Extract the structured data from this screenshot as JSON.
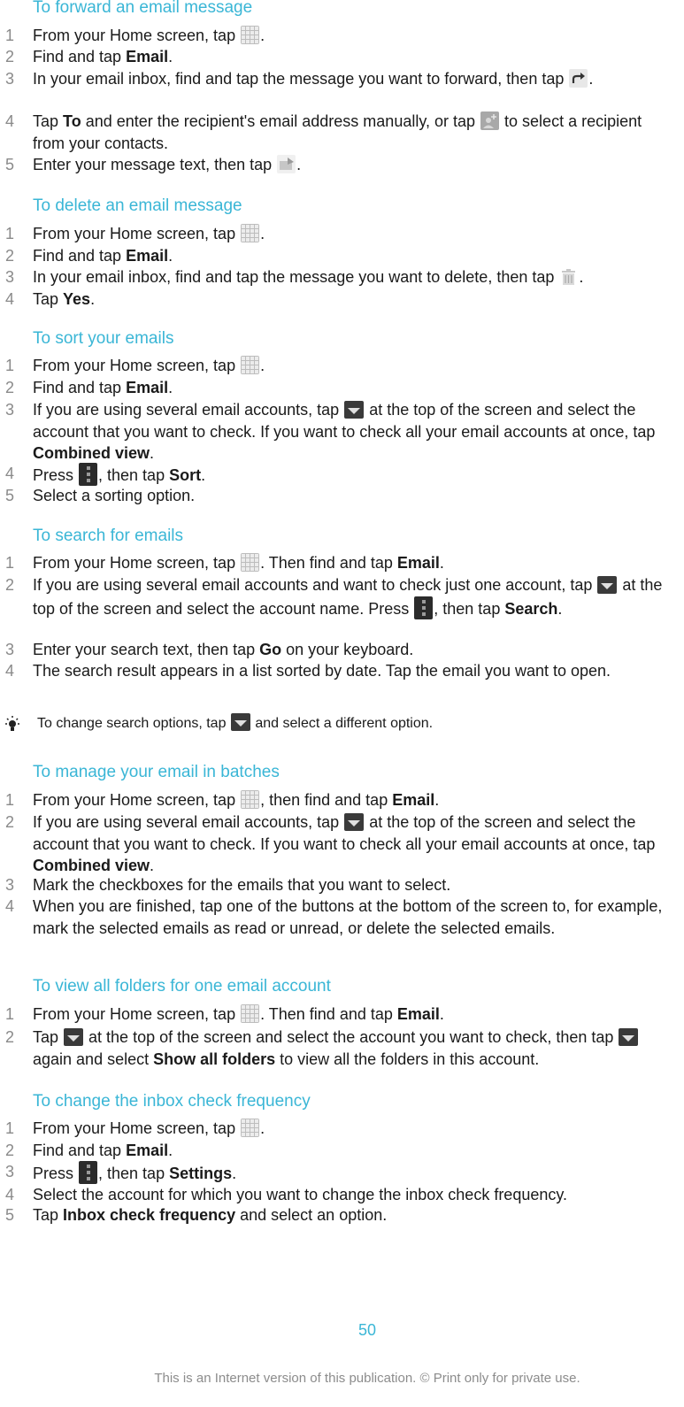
{
  "sections": [
    {
      "heading": "To forward an email message",
      "steps": [
        {
          "num": "1",
          "parts": [
            {
              "t": "From your Home screen, tap "
            },
            {
              "icon": "apps-grid-icon"
            },
            {
              "t": "."
            }
          ]
        },
        {
          "num": "2",
          "parts": [
            {
              "t": "Find and tap "
            },
            {
              "b": "Email"
            },
            {
              "t": "."
            }
          ]
        },
        {
          "num": "3",
          "parts": [
            {
              "t": "In your email inbox, find and tap the message you want to forward, then tap "
            },
            {
              "icon": "forward-arrow-icon"
            },
            {
              "t": "."
            }
          ]
        },
        {
          "num": "4",
          "parts": [
            {
              "t": "Tap "
            },
            {
              "b": "To"
            },
            {
              "t": " and enter the recipient's email address manually, or tap "
            },
            {
              "icon": "add-contact-icon"
            },
            {
              "t": " to select a recipient from your contacts."
            }
          ]
        },
        {
          "num": "5",
          "parts": [
            {
              "t": "Enter your message text, then tap "
            },
            {
              "icon": "send-icon"
            },
            {
              "t": "."
            }
          ]
        }
      ]
    },
    {
      "heading": "To delete an email message",
      "steps": [
        {
          "num": "1",
          "parts": [
            {
              "t": "From your Home screen, tap "
            },
            {
              "icon": "apps-grid-icon"
            },
            {
              "t": "."
            }
          ]
        },
        {
          "num": "2",
          "parts": [
            {
              "t": "Find and tap "
            },
            {
              "b": "Email"
            },
            {
              "t": "."
            }
          ]
        },
        {
          "num": "3",
          "parts": [
            {
              "t": "In your email inbox, find and tap the message you want to delete, then tap "
            },
            {
              "icon": "trash-icon"
            },
            {
              "t": "."
            }
          ]
        },
        {
          "num": "4",
          "parts": [
            {
              "t": "Tap "
            },
            {
              "b": "Yes"
            },
            {
              "t": "."
            }
          ]
        }
      ]
    },
    {
      "heading": "To sort your emails",
      "steps": [
        {
          "num": "1",
          "parts": [
            {
              "t": "From your Home screen, tap "
            },
            {
              "icon": "apps-grid-icon"
            },
            {
              "t": "."
            }
          ]
        },
        {
          "num": "2",
          "parts": [
            {
              "t": "Find and tap "
            },
            {
              "b": "Email"
            },
            {
              "t": "."
            }
          ]
        },
        {
          "num": "3",
          "parts": [
            {
              "t": "If you are using several email accounts, tap "
            },
            {
              "icon": "dropdown-icon"
            },
            {
              "t": " at the top of the screen and select the account that you want to check. If you want to check all your email accounts at once, tap "
            },
            {
              "b": "Combined view"
            },
            {
              "t": "."
            }
          ]
        },
        {
          "num": "4",
          "parts": [
            {
              "t": "Press "
            },
            {
              "icon": "menu-key-icon"
            },
            {
              "t": ", then tap "
            },
            {
              "b": "Sort"
            },
            {
              "t": "."
            }
          ]
        },
        {
          "num": "5",
          "parts": [
            {
              "t": "Select a sorting option."
            }
          ]
        }
      ]
    },
    {
      "heading": "To search for emails",
      "steps": [
        {
          "num": "1",
          "parts": [
            {
              "t": "From your Home screen, tap "
            },
            {
              "icon": "apps-grid-icon"
            },
            {
              "t": ". Then find and tap "
            },
            {
              "b": "Email"
            },
            {
              "t": "."
            }
          ]
        },
        {
          "num": "2",
          "parts": [
            {
              "t": "If you are using several email accounts and want to check just one account, tap "
            },
            {
              "icon": "dropdown-icon"
            },
            {
              "t": " at the top of the screen and select the account name. Press "
            },
            {
              "icon": "menu-key-icon"
            },
            {
              "t": ", then tap "
            },
            {
              "b": "Search"
            },
            {
              "t": "."
            }
          ]
        },
        {
          "num": "3",
          "parts": [
            {
              "t": "Enter your search text, then tap "
            },
            {
              "b": "Go"
            },
            {
              "t": " on your keyboard."
            }
          ]
        },
        {
          "num": "4",
          "parts": [
            {
              "t": "The search result appears in a list sorted by date. Tap the email you want to open."
            }
          ]
        }
      ],
      "tip": {
        "parts": [
          {
            "t": "To change search options, tap "
          },
          {
            "icon": "dropdown-icon"
          },
          {
            "t": " and select a different option."
          }
        ]
      }
    },
    {
      "heading": "To manage your email in batches",
      "steps": [
        {
          "num": "1",
          "parts": [
            {
              "t": "From your Home screen, tap "
            },
            {
              "icon": "apps-grid-icon"
            },
            {
              "t": ", then find and tap "
            },
            {
              "b": "Email"
            },
            {
              "t": "."
            }
          ]
        },
        {
          "num": "2",
          "parts": [
            {
              "t": "If you are using several email accounts, tap "
            },
            {
              "icon": "dropdown-icon"
            },
            {
              "t": " at the top of the screen and select the account that you want to check. If you want to check all your email accounts at once, tap "
            },
            {
              "b": "Combined view"
            },
            {
              "t": "."
            }
          ]
        },
        {
          "num": "3",
          "parts": [
            {
              "t": "Mark the checkboxes for the emails that you want to select."
            }
          ]
        },
        {
          "num": "4",
          "parts": [
            {
              "t": "When you are finished, tap one of the buttons at the bottom of the screen to, for example, mark the selected emails as read or unread, or delete the selected emails."
            }
          ]
        }
      ]
    },
    {
      "heading": "To view all folders for one email account",
      "steps": [
        {
          "num": "1",
          "parts": [
            {
              "t": "From your Home screen, tap "
            },
            {
              "icon": "apps-grid-icon"
            },
            {
              "t": ". Then find and tap "
            },
            {
              "b": "Email"
            },
            {
              "t": "."
            }
          ]
        },
        {
          "num": "2",
          "parts": [
            {
              "t": "Tap "
            },
            {
              "icon": "dropdown-icon"
            },
            {
              "t": " at the top of the screen and select the account you want to check, then tap "
            },
            {
              "icon": "dropdown-icon"
            },
            {
              "t": " again and select "
            },
            {
              "b": "Show all folders"
            },
            {
              "t": " to view all the folders in this account."
            }
          ]
        }
      ]
    },
    {
      "heading": "To change the inbox check frequency",
      "steps": [
        {
          "num": "1",
          "parts": [
            {
              "t": "From your Home screen, tap "
            },
            {
              "icon": "apps-grid-icon"
            },
            {
              "t": "."
            }
          ]
        },
        {
          "num": "2",
          "parts": [
            {
              "t": "Find and tap "
            },
            {
              "b": "Email"
            },
            {
              "t": "."
            }
          ]
        },
        {
          "num": "3",
          "parts": [
            {
              "t": "Press "
            },
            {
              "icon": "menu-key-icon"
            },
            {
              "t": ", then tap "
            },
            {
              "b": "Settings"
            },
            {
              "t": "."
            }
          ]
        },
        {
          "num": "4",
          "parts": [
            {
              "t": "Select the account for which you want to change the inbox check frequency."
            }
          ]
        },
        {
          "num": "5",
          "parts": [
            {
              "t": "Tap "
            },
            {
              "b": "Inbox check frequency"
            },
            {
              "t": " and select an option."
            }
          ]
        }
      ]
    }
  ],
  "page_number": "50",
  "footer": "This is an Internet version of this publication. © Print only for private use.",
  "colors": {
    "heading": "#3ab6d6",
    "step_number": "#8a8a8a",
    "footer": "#8c8c8c"
  }
}
